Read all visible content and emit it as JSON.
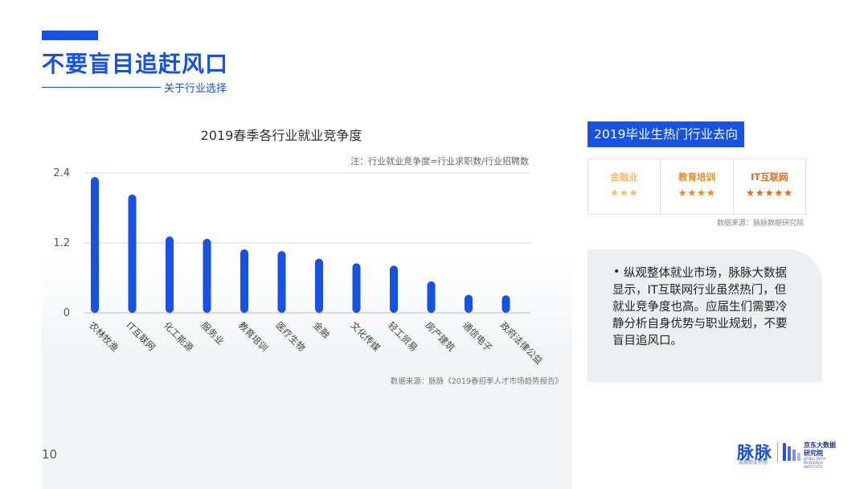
{
  "header": {
    "title": "不要盲目追赶风口",
    "subtitle": "关于行业选择"
  },
  "chart_data": {
    "type": "bar",
    "title": "2019春季各行业就业竞争度",
    "note": "注：行业就业竞争度=行业求职数/行业招聘数",
    "categories": [
      "农林牧渔",
      "IT互联网",
      "化工能源",
      "服务业",
      "教育培训",
      "医疗生物",
      "金融",
      "文化传媒",
      "轻工贸易",
      "房产建筑",
      "通信电子",
      "政府法律公益"
    ],
    "values": [
      2.33,
      2.03,
      1.31,
      1.27,
      1.09,
      1.06,
      0.93,
      0.85,
      0.81,
      0.54,
      0.31,
      0.3
    ],
    "ylim": [
      0,
      2.4
    ],
    "yticks": [
      "0",
      "1.2",
      "2.4"
    ],
    "ytick_values": [
      0,
      1.2,
      2.4
    ],
    "grid": true,
    "bar_color": "#1652e6",
    "source": "数据来源：脉脉《2019春招季人才市场趋势报告》"
  },
  "hot_industries": {
    "title": "2019毕业生热门行业去向",
    "items": [
      {
        "name": "金融业",
        "stars": "★★★",
        "color": "#f5be6b"
      },
      {
        "name": "教育培训",
        "stars": "★★★★",
        "color": "#ee8a1e"
      },
      {
        "name": "IT互联网",
        "stars": "★★★★★",
        "color": "#ec6a17"
      }
    ],
    "source": "数据来源：脉脉数据研究院"
  },
  "summary": {
    "bullet": "•",
    "text": "纵观整体就业市场，脉脉大数据显示，IT互联网行业虽然热门，但就业竞争度也高。应届生们需要冷静分析自身优势与职业规划，不要盲目追风口。"
  },
  "footer": {
    "page_number": "10",
    "logo_main": "脉脉",
    "logo_sub": "成就职业梦想",
    "logo_jd_line1": "京东大数据",
    "logo_jd_line2": "研究院",
    "logo_jd_en": "JD BIG DATA RESEARCH INSTITUTE"
  }
}
